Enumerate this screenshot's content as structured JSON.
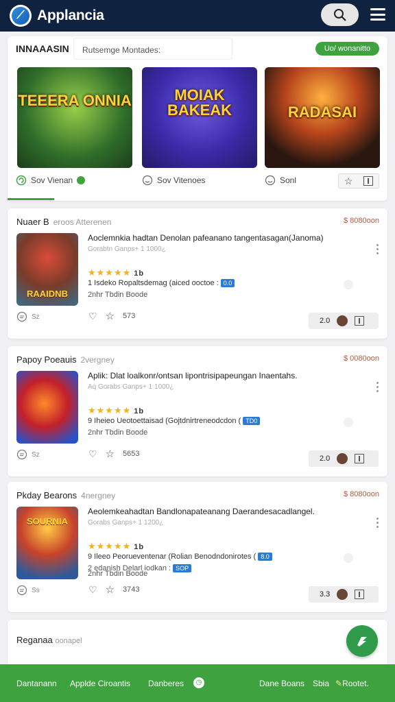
{
  "header": {
    "brand": "Applancia",
    "logo_icon": "a-logo-icon",
    "search_icon": "search-icon",
    "menu_icon": "hamburger-menu-icon",
    "colors": {
      "bar": "#0f2340",
      "accent": "#3ea33e"
    }
  },
  "featured": {
    "title": "INNAAASIN",
    "search_value": "Rutsemge Montades:",
    "badge": "Uo/ wonanitto",
    "tiles": [
      {
        "art": "TEEERA ONNIA",
        "label": "Sov Vienan"
      },
      {
        "art": "MOIAK BAKEAK",
        "label": "Sov Vitenoes"
      },
      {
        "art": "RADASAI",
        "label": "Sonl"
      }
    ]
  },
  "apps": [
    {
      "title": "Nuaer B",
      "title_sub": "eroos  Atterenen",
      "price": "$ 8080oon",
      "art": "RAAIDNB",
      "desc": "Aoclemnkia hadtan Denolan pafeanano tangentasagan(Janoma)",
      "meta": "Gorabtn  Ganps+ 1  1000¿",
      "rating": "1b",
      "line2": "1 Isdeko Ropaltsdemag (aiced ooctoe :",
      "line2_tag": "0.0",
      "line3": "2nhr  Tbdin  Boode",
      "foot_left": "Sz",
      "foot_count": "573",
      "foot_num": "2.0"
    },
    {
      "title": "Papoy Poeauis",
      "title_sub": "2vergney",
      "price": "$ 0080oon",
      "art": "",
      "desc": "Aplik: Dlat loalkonr/ontsan lipontrisipapeungan Inaentahs.",
      "meta": "Aq  Gorabs  Ganps+ 1  1000¿",
      "rating": "1b",
      "line2": "9 Iheieo Ueotoettaisad (Gojtdnirtreneodcdon (",
      "line2_tag": "TD0",
      "line3": "2nhr  Tbdin  Boode",
      "foot_left": "Sz",
      "foot_count": "5653",
      "foot_num": "2.0"
    },
    {
      "title": "Pkday Bearons",
      "title_sub": "4nergney",
      "price": "$ 8080oon",
      "art": "SOURNIA",
      "desc": "Aeolemkeahadtan Bandlonapateanang Daerandesacadlangel.",
      "meta": "Gorabs  Ganps+ 1  1200¿",
      "rating": "1b",
      "line2": "9 Ileeo Peorueventenar (Rolian Benodndonirotes (",
      "line2_tag": "8.0",
      "line3": "2 edanish Delarl iodkan :",
      "line3_tag": "SOP",
      "line4": "2nhr  Tbdin  Boode",
      "foot_left": "Ss",
      "foot_count": "3743",
      "foot_num": "3.3"
    }
  ],
  "partial": {
    "title": "Reganaa",
    "title_sub": "oonapel"
  },
  "bottom_nav": {
    "item1": "Dantanann",
    "item2": "Applde  Ciroantis",
    "item3": "Danberes",
    "item4": "Dane Boans",
    "item5": "Sbia",
    "item6": "Rootet."
  }
}
